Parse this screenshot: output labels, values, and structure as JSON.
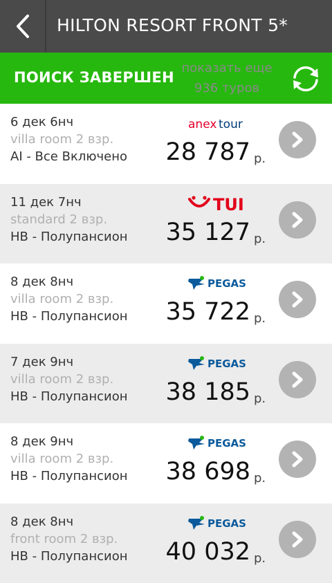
{
  "header": {
    "title": "HILTON RESORT FRONT 5*",
    "back_icon": "chevron-left-icon"
  },
  "status_bar": {
    "status": "ПОИСК ЗАВЕРШЕН",
    "show_more_line1": "показать еще",
    "show_more_line2": "936 туров",
    "refresh_icon": "refresh-icon"
  },
  "currency": "р.",
  "tours": [
    {
      "date": "6 дек 6нч",
      "room": "villa room 2 взр.",
      "meal": "AI - Все Включено",
      "operator": "anex tour",
      "price": "28 787"
    },
    {
      "date": "11 дек 7нч",
      "room": "standard 2 взр.",
      "meal": "HB - Полупансион",
      "operator": "TUI",
      "price": "35 127"
    },
    {
      "date": "8 дек 8нч",
      "room": "villa room 2 взр.",
      "meal": "HB - Полупансион",
      "operator": "PEGAS",
      "price": "35 722"
    },
    {
      "date": "7 дек 9нч",
      "room": "villa room 2 взр.",
      "meal": "HB - Полупансион",
      "operator": "PEGAS",
      "price": "38 185"
    },
    {
      "date": "8 дек 9нч",
      "room": "villa room 2 взр.",
      "meal": "HB - Полупансион",
      "operator": "PEGAS",
      "price": "38 698"
    },
    {
      "date": "8 дек 8нч",
      "room": "front room 2 взр.",
      "meal": "HB - Полупансион",
      "operator": "PEGAS",
      "price": "40 032"
    }
  ],
  "colors": {
    "header_bg": "#4a4a4a",
    "accent_green": "#27b80f",
    "row_alt_bg": "#ececec",
    "button_grey": "#b3b3b3",
    "anex_red": "#e4002b",
    "anex_blue": "#003b7a",
    "tui_red": "#e2001a",
    "pegas_blue": "#0a5a9c"
  }
}
